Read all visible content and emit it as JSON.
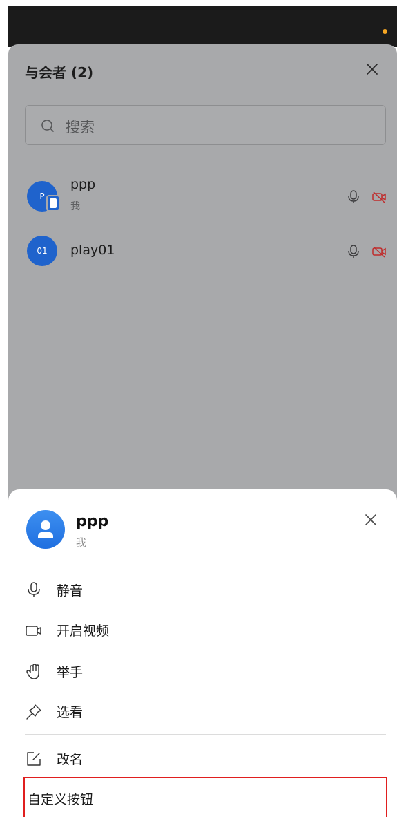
{
  "panel": {
    "title": "与会者 (2)",
    "search_placeholder": "搜索"
  },
  "participants": [
    {
      "avatar_text": "P",
      "name": "ppp",
      "sub": "我",
      "mic_icon": "mic-icon",
      "camera_icon": "camera-off-icon"
    },
    {
      "avatar_text": "01",
      "name": "play01",
      "sub": "",
      "mic_icon": "mic-icon",
      "camera_icon": "camera-off-icon"
    }
  ],
  "sheet": {
    "name": "ppp",
    "sub": "我",
    "actions": [
      {
        "label": "静音",
        "icon": "mic-icon"
      },
      {
        "label": "开启视频",
        "icon": "video-camera-icon"
      },
      {
        "label": "举手",
        "icon": "raise-hand-icon"
      },
      {
        "label": "选看",
        "icon": "pin-icon"
      },
      {
        "label": "改名",
        "icon": "edit-icon"
      }
    ],
    "custom_button_label": "自定义按钮"
  },
  "colors": {
    "accent": "#1f63cc",
    "highlight_border": "#e01f1f",
    "status_dot": "#f5a623"
  }
}
